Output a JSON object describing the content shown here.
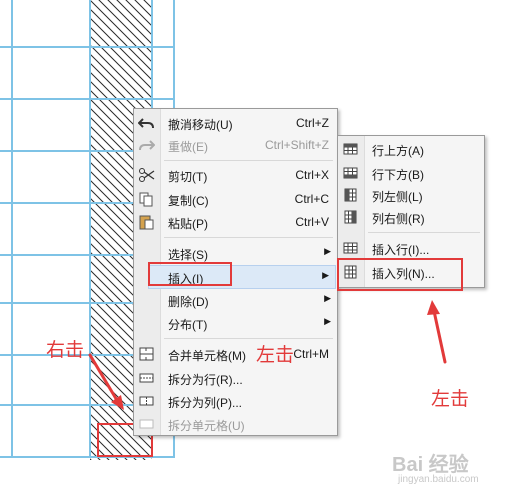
{
  "context_menu": {
    "items": [
      {
        "icon": "undo-icon",
        "label": "撤消移动(U)",
        "shortcut": "Ctrl+Z",
        "disabled": false
      },
      {
        "icon": "redo-icon",
        "label": "重做(E)",
        "shortcut": "Ctrl+Shift+Z",
        "disabled": true
      },
      {
        "icon": "cut-icon",
        "label": "剪切(T)",
        "shortcut": "Ctrl+X",
        "disabled": false
      },
      {
        "icon": "copy-icon",
        "label": "复制(C)",
        "shortcut": "Ctrl+C",
        "disabled": false
      },
      {
        "icon": "paste-icon",
        "label": "粘贴(P)",
        "shortcut": "Ctrl+V",
        "disabled": false
      },
      {
        "icon": "",
        "label": "选择(S)",
        "shortcut": "",
        "submenu": true
      },
      {
        "icon": "",
        "label": "插入(I)",
        "shortcut": "",
        "submenu": true,
        "highlighted": true
      },
      {
        "icon": "",
        "label": "删除(D)",
        "shortcut": "",
        "submenu": true
      },
      {
        "icon": "",
        "label": "分布(T)",
        "shortcut": "",
        "submenu": true
      },
      {
        "icon": "merge-cells-icon",
        "label": "合并单元格(M)",
        "shortcut": "Ctrl+M",
        "disabled": false
      },
      {
        "icon": "split-rows-icon",
        "label": "拆分为行(R)...",
        "shortcut": "",
        "disabled": false
      },
      {
        "icon": "split-columns-icon",
        "label": "拆分为列(P)...",
        "shortcut": "",
        "disabled": false
      },
      {
        "icon": "split-cell-icon",
        "label": "拆分单元格(U)",
        "shortcut": "",
        "disabled": true
      }
    ]
  },
  "submenu": {
    "items": [
      {
        "icon": "row-above-icon",
        "label": "行上方(A)"
      },
      {
        "icon": "row-below-icon",
        "label": "行下方(B)"
      },
      {
        "icon": "column-left-icon",
        "label": "列左侧(L)"
      },
      {
        "icon": "column-right-icon",
        "label": "列右侧(R)"
      },
      {
        "icon": "insert-row-icon",
        "label": "插入行(I)..."
      },
      {
        "icon": "insert-column-icon",
        "label": "插入列(N)..."
      }
    ]
  },
  "annotations": {
    "right_click": "右击",
    "left_click_1": "左击",
    "left_click_2": "左击"
  },
  "watermark": {
    "brand": "Bai 经验",
    "url": "jingyan.baidu.com"
  },
  "colors": {
    "grid_line": "#7ec3e6",
    "annotation_red": "#e23a3a",
    "menu_bg": "#f5f5f5",
    "highlight": "#dce9f7"
  }
}
